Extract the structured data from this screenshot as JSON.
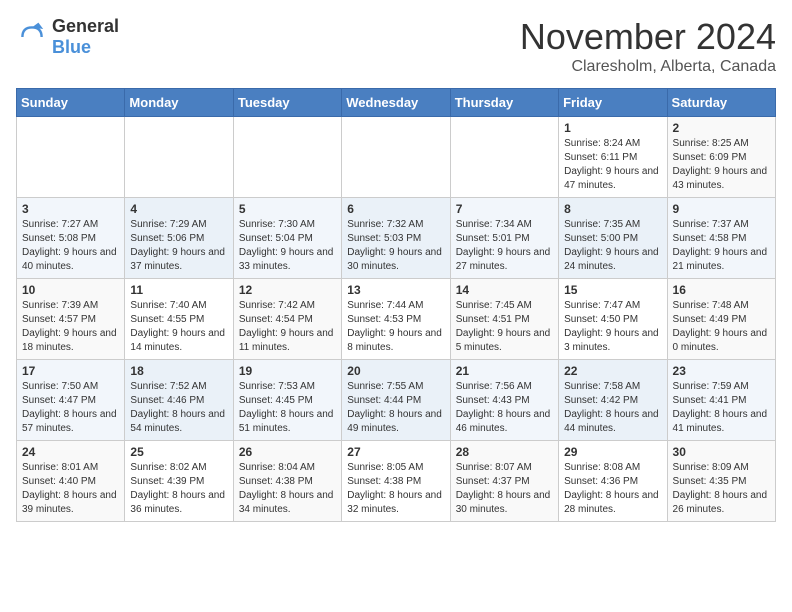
{
  "logo": {
    "general": "General",
    "blue": "Blue"
  },
  "header": {
    "month": "November 2024",
    "location": "Claresholm, Alberta, Canada"
  },
  "weekdays": [
    "Sunday",
    "Monday",
    "Tuesday",
    "Wednesday",
    "Thursday",
    "Friday",
    "Saturday"
  ],
  "weeks": [
    [
      null,
      null,
      null,
      null,
      null,
      {
        "day": "1",
        "sunrise": "Sunrise: 8:24 AM",
        "sunset": "Sunset: 6:11 PM",
        "daylight": "Daylight: 9 hours and 47 minutes."
      },
      {
        "day": "2",
        "sunrise": "Sunrise: 8:25 AM",
        "sunset": "Sunset: 6:09 PM",
        "daylight": "Daylight: 9 hours and 43 minutes."
      }
    ],
    [
      {
        "day": "3",
        "sunrise": "Sunrise: 7:27 AM",
        "sunset": "Sunset: 5:08 PM",
        "daylight": "Daylight: 9 hours and 40 minutes."
      },
      {
        "day": "4",
        "sunrise": "Sunrise: 7:29 AM",
        "sunset": "Sunset: 5:06 PM",
        "daylight": "Daylight: 9 hours and 37 minutes."
      },
      {
        "day": "5",
        "sunrise": "Sunrise: 7:30 AM",
        "sunset": "Sunset: 5:04 PM",
        "daylight": "Daylight: 9 hours and 33 minutes."
      },
      {
        "day": "6",
        "sunrise": "Sunrise: 7:32 AM",
        "sunset": "Sunset: 5:03 PM",
        "daylight": "Daylight: 9 hours and 30 minutes."
      },
      {
        "day": "7",
        "sunrise": "Sunrise: 7:34 AM",
        "sunset": "Sunset: 5:01 PM",
        "daylight": "Daylight: 9 hours and 27 minutes."
      },
      {
        "day": "8",
        "sunrise": "Sunrise: 7:35 AM",
        "sunset": "Sunset: 5:00 PM",
        "daylight": "Daylight: 9 hours and 24 minutes."
      },
      {
        "day": "9",
        "sunrise": "Sunrise: 7:37 AM",
        "sunset": "Sunset: 4:58 PM",
        "daylight": "Daylight: 9 hours and 21 minutes."
      }
    ],
    [
      {
        "day": "10",
        "sunrise": "Sunrise: 7:39 AM",
        "sunset": "Sunset: 4:57 PM",
        "daylight": "Daylight: 9 hours and 18 minutes."
      },
      {
        "day": "11",
        "sunrise": "Sunrise: 7:40 AM",
        "sunset": "Sunset: 4:55 PM",
        "daylight": "Daylight: 9 hours and 14 minutes."
      },
      {
        "day": "12",
        "sunrise": "Sunrise: 7:42 AM",
        "sunset": "Sunset: 4:54 PM",
        "daylight": "Daylight: 9 hours and 11 minutes."
      },
      {
        "day": "13",
        "sunrise": "Sunrise: 7:44 AM",
        "sunset": "Sunset: 4:53 PM",
        "daylight": "Daylight: 9 hours and 8 minutes."
      },
      {
        "day": "14",
        "sunrise": "Sunrise: 7:45 AM",
        "sunset": "Sunset: 4:51 PM",
        "daylight": "Daylight: 9 hours and 5 minutes."
      },
      {
        "day": "15",
        "sunrise": "Sunrise: 7:47 AM",
        "sunset": "Sunset: 4:50 PM",
        "daylight": "Daylight: 9 hours and 3 minutes."
      },
      {
        "day": "16",
        "sunrise": "Sunrise: 7:48 AM",
        "sunset": "Sunset: 4:49 PM",
        "daylight": "Daylight: 9 hours and 0 minutes."
      }
    ],
    [
      {
        "day": "17",
        "sunrise": "Sunrise: 7:50 AM",
        "sunset": "Sunset: 4:47 PM",
        "daylight": "Daylight: 8 hours and 57 minutes."
      },
      {
        "day": "18",
        "sunrise": "Sunrise: 7:52 AM",
        "sunset": "Sunset: 4:46 PM",
        "daylight": "Daylight: 8 hours and 54 minutes."
      },
      {
        "day": "19",
        "sunrise": "Sunrise: 7:53 AM",
        "sunset": "Sunset: 4:45 PM",
        "daylight": "Daylight: 8 hours and 51 minutes."
      },
      {
        "day": "20",
        "sunrise": "Sunrise: 7:55 AM",
        "sunset": "Sunset: 4:44 PM",
        "daylight": "Daylight: 8 hours and 49 minutes."
      },
      {
        "day": "21",
        "sunrise": "Sunrise: 7:56 AM",
        "sunset": "Sunset: 4:43 PM",
        "daylight": "Daylight: 8 hours and 46 minutes."
      },
      {
        "day": "22",
        "sunrise": "Sunrise: 7:58 AM",
        "sunset": "Sunset: 4:42 PM",
        "daylight": "Daylight: 8 hours and 44 minutes."
      },
      {
        "day": "23",
        "sunrise": "Sunrise: 7:59 AM",
        "sunset": "Sunset: 4:41 PM",
        "daylight": "Daylight: 8 hours and 41 minutes."
      }
    ],
    [
      {
        "day": "24",
        "sunrise": "Sunrise: 8:01 AM",
        "sunset": "Sunset: 4:40 PM",
        "daylight": "Daylight: 8 hours and 39 minutes."
      },
      {
        "day": "25",
        "sunrise": "Sunrise: 8:02 AM",
        "sunset": "Sunset: 4:39 PM",
        "daylight": "Daylight: 8 hours and 36 minutes."
      },
      {
        "day": "26",
        "sunrise": "Sunrise: 8:04 AM",
        "sunset": "Sunset: 4:38 PM",
        "daylight": "Daylight: 8 hours and 34 minutes."
      },
      {
        "day": "27",
        "sunrise": "Sunrise: 8:05 AM",
        "sunset": "Sunset: 4:38 PM",
        "daylight": "Daylight: 8 hours and 32 minutes."
      },
      {
        "day": "28",
        "sunrise": "Sunrise: 8:07 AM",
        "sunset": "Sunset: 4:37 PM",
        "daylight": "Daylight: 8 hours and 30 minutes."
      },
      {
        "day": "29",
        "sunrise": "Sunrise: 8:08 AM",
        "sunset": "Sunset: 4:36 PM",
        "daylight": "Daylight: 8 hours and 28 minutes."
      },
      {
        "day": "30",
        "sunrise": "Sunrise: 8:09 AM",
        "sunset": "Sunset: 4:35 PM",
        "daylight": "Daylight: 8 hours and 26 minutes."
      }
    ]
  ]
}
